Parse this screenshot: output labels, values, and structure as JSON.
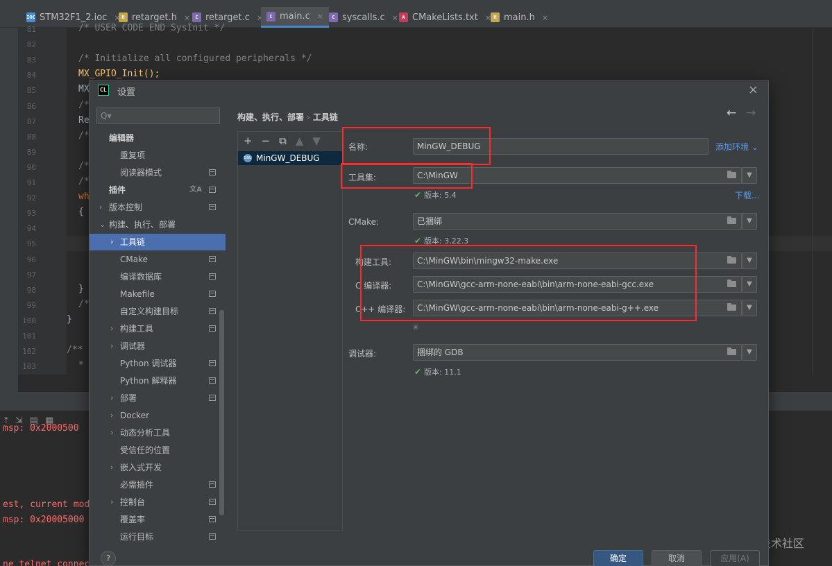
{
  "editor_tabs": [
    {
      "label": "STM32F1_2.ioc",
      "type": "IOC",
      "color": "#4e8cd0"
    },
    {
      "label": "retarget.h",
      "type": "H",
      "color": "#c9a54c"
    },
    {
      "label": "retarget.c",
      "type": "C",
      "color": "#7f6ab1"
    },
    {
      "label": "main.c",
      "type": "C",
      "color": "#7f6ab1"
    },
    {
      "label": "syscalls.c",
      "type": "C",
      "color": "#7f6ab1"
    },
    {
      "label": "CMakeLists.txt",
      "type": "A",
      "color": "#c23d5a"
    },
    {
      "label": "main.h",
      "type": "H",
      "color": "#c9a54c"
    }
  ],
  "code_lines": [
    {
      "n": "81",
      "text": "/* USER CODE END SysInit */"
    },
    {
      "n": "82",
      "text": ""
    },
    {
      "n": "83",
      "text": "/* Initialize all configured peripherals */"
    },
    {
      "n": "84",
      "text": "MX_GPIO_Init();"
    },
    {
      "n": "85",
      "text": "MX"
    },
    {
      "n": "86",
      "text": "/*"
    },
    {
      "n": "87",
      "text": "Re"
    },
    {
      "n": "88",
      "text": "/*"
    },
    {
      "n": "89",
      "text": ""
    },
    {
      "n": "90",
      "text": "/*"
    },
    {
      "n": "91",
      "text": "/*"
    },
    {
      "n": "92",
      "text": "wh"
    },
    {
      "n": "93",
      "text": "{"
    },
    {
      "n": "94",
      "text": ""
    },
    {
      "n": "95",
      "text": ""
    },
    {
      "n": "96",
      "text": ""
    },
    {
      "n": "97",
      "text": ""
    },
    {
      "n": "98",
      "text": "}"
    },
    {
      "n": "99",
      "text": "/*"
    },
    {
      "n": "100",
      "text": "}"
    },
    {
      "n": "101",
      "text": ""
    },
    {
      "n": "102",
      "text": "/**"
    },
    {
      "n": "103",
      "text": "*"
    }
  ],
  "console_lines": [
    "msp: 0x2000500",
    "est, current mod",
    "msp: 0x20005000",
    "ne telnet connec"
  ],
  "watermark": "@稀土掘金技术社区",
  "dialog": {
    "title": "设置",
    "logo": "CL",
    "search_placeholder": "Q▾",
    "breadcrumb": [
      "构建、执行、部署",
      "工具链"
    ],
    "tree": [
      {
        "label": "编辑器",
        "bold": true,
        "indent": 0,
        "arrow": ""
      },
      {
        "label": "重复项",
        "indent": 1,
        "arrow": ""
      },
      {
        "label": "阅读器模式",
        "indent": 1,
        "arrow": "",
        "project": true
      },
      {
        "label": "插件",
        "bold": true,
        "indent": 0,
        "arrow": "",
        "project": true,
        "lang": true
      },
      {
        "label": "版本控制",
        "indent": 0,
        "arrow": "›",
        "project": true
      },
      {
        "label": "构建、执行、部署",
        "indent": 0,
        "arrow": "⌄"
      },
      {
        "label": "工具链",
        "indent": 1,
        "arrow": "›",
        "selected": true
      },
      {
        "label": "CMake",
        "indent": 1,
        "arrow": "",
        "project": true
      },
      {
        "label": "编译数据库",
        "indent": 1,
        "arrow": "",
        "project": true
      },
      {
        "label": "Makefile",
        "indent": 1,
        "arrow": "",
        "project": true
      },
      {
        "label": "自定义构建目标",
        "indent": 1,
        "arrow": "",
        "project": true
      },
      {
        "label": "构建工具",
        "indent": 1,
        "arrow": "›",
        "project": true
      },
      {
        "label": "调试器",
        "indent": 1,
        "arrow": "›"
      },
      {
        "label": "Python 调试器",
        "indent": 1,
        "arrow": "",
        "project": true
      },
      {
        "label": "Python 解释器",
        "indent": 1,
        "arrow": "",
        "project": true
      },
      {
        "label": "部署",
        "indent": 1,
        "arrow": "›",
        "project": true
      },
      {
        "label": "Docker",
        "indent": 1,
        "arrow": "›"
      },
      {
        "label": "动态分析工具",
        "indent": 1,
        "arrow": "›"
      },
      {
        "label": "受信任的位置",
        "indent": 1,
        "arrow": ""
      },
      {
        "label": "嵌入式开发",
        "indent": 1,
        "arrow": "›"
      },
      {
        "label": "必需插件",
        "indent": 1,
        "arrow": "",
        "project": true
      },
      {
        "label": "控制台",
        "indent": 1,
        "arrow": "›",
        "project": true
      },
      {
        "label": "覆盖率",
        "indent": 1,
        "arrow": "",
        "project": true
      },
      {
        "label": "运行目标",
        "indent": 1,
        "arrow": "",
        "project": true
      }
    ],
    "toolchains": [
      {
        "name": "MinGW_DEBUG",
        "icon": "GNU"
      }
    ],
    "form": {
      "name_label": "名称:",
      "name_value": "MinGW_DEBUG",
      "add_env_label": "添加环境",
      "toolset_label": "工具集:",
      "toolset_value": "C:\\MinGW",
      "toolset_version": "版本: 5.4",
      "download_label": "下载...",
      "cmake_label": "CMake:",
      "cmake_value": "已捆绑",
      "cmake_version": "版本: 3.22.3",
      "build_tool_label": "构建工具:",
      "build_tool_value": "C:\\MinGW\\bin\\mingw32-make.exe",
      "c_compiler_label": "C 编译器:",
      "c_compiler_value": "C:\\MinGW\\gcc-arm-none-eabi\\bin\\arm-none-eabi-gcc.exe",
      "cxx_compiler_label": "C++ 编译器:",
      "cxx_compiler_value": "C:\\MinGW\\gcc-arm-none-eabi\\bin\\arm-none-eabi-g++.exe",
      "debugger_label": "调试器:",
      "debugger_value": "捆绑的 GDB",
      "debugger_version": "版本: 11.1"
    },
    "buttons": {
      "help": "?",
      "ok": "确定",
      "cancel": "取消",
      "apply": "应用(A)"
    }
  }
}
